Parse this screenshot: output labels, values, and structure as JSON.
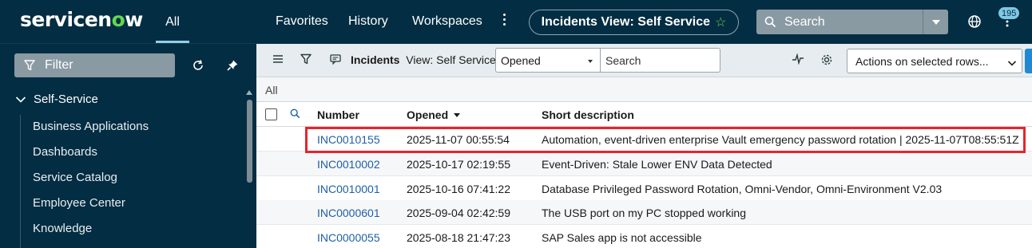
{
  "brand": {
    "logo_text_a": "servicen",
    "logo_text_o": "o",
    "logo_text_b": "w"
  },
  "nav": {
    "all_tab": "All",
    "filter_label": "Filter",
    "section": "Self-Service",
    "items": [
      "Business Applications",
      "Dashboards",
      "Service Catalog",
      "Employee Center",
      "Knowledge"
    ]
  },
  "header": {
    "links": [
      "Favorites",
      "History",
      "Workspaces"
    ],
    "context": "Incidents View: Self Service",
    "search_label": "Search",
    "notification_count": "195"
  },
  "toolbar": {
    "title_bold": "Incidents",
    "title_rest": "View: Self Service",
    "search_field": "Opened",
    "search_placeholder": "Search",
    "actions": "Actions on selected rows..."
  },
  "breadcrumb": "All",
  "table": {
    "columns": [
      "Number",
      "Opened",
      "Short description"
    ],
    "rows": [
      {
        "number": "INC0010155",
        "opened": "2025-11-07 00:55:54",
        "desc": "Automation, event-driven enterprise Vault emergency password rotation | 2025-11-07T08:55:51Z"
      },
      {
        "number": "INC0010002",
        "opened": "2025-10-17 02:19:55",
        "desc": "Event-Driven: Stale Lower ENV Data Detected"
      },
      {
        "number": "INC0010001",
        "opened": "2025-10-16 07:41:22",
        "desc": "Database Privileged Password Rotation, Omni-Vendor, Omni-Environment V2.03"
      },
      {
        "number": "INC0000601",
        "opened": "2025-09-04 02:42:59",
        "desc": "The USB port on my PC stopped working"
      },
      {
        "number": "INC0000055",
        "opened": "2025-08-18 21:47:23",
        "desc": "SAP Sales app is not accessible"
      }
    ]
  },
  "colors": {
    "nav_bg": "#032d42",
    "link": "#1f5fa8",
    "highlight": "#e3262c",
    "accent_green": "#62d84e"
  }
}
